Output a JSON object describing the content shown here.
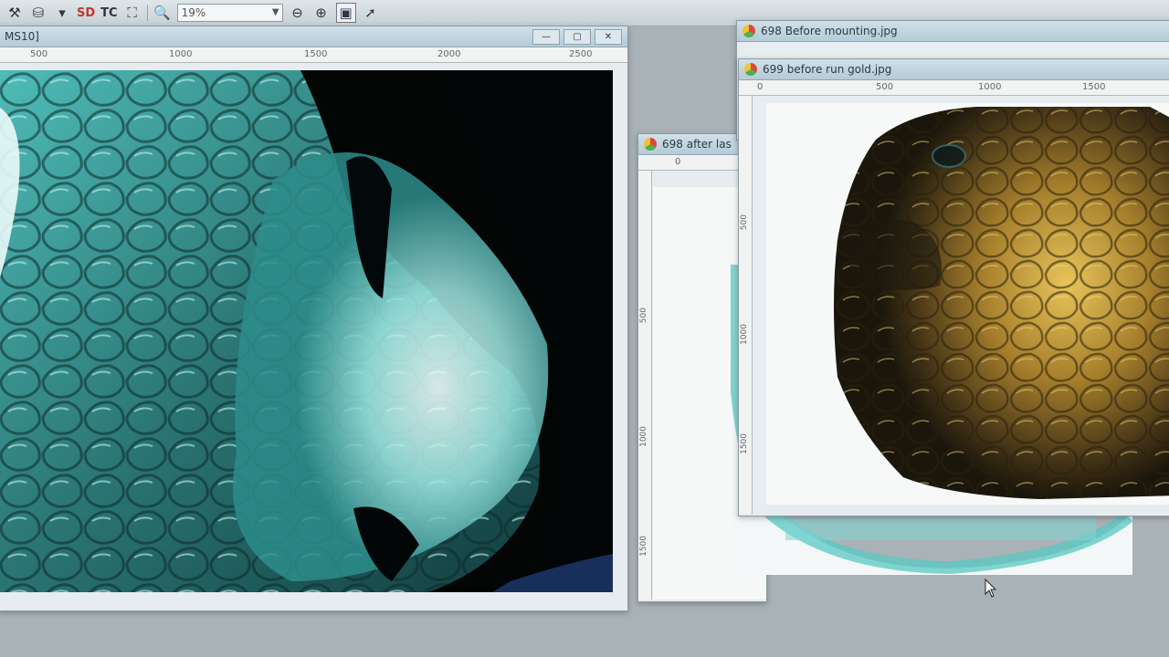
{
  "toolbar": {
    "zoom_value": "19%",
    "label_sd": "SD",
    "label_tc": "TC"
  },
  "windows": {
    "main": {
      "title": "MS10]",
      "ruler_ticks": [
        "500",
        "1000",
        "1500",
        "2000",
        "2500"
      ]
    },
    "w698_before": {
      "title": "698 Before mounting.jpg"
    },
    "w699": {
      "title": "699 before run gold.jpg",
      "ruler_ticks": [
        "0",
        "500",
        "1000",
        "1500"
      ],
      "vruler_ticks": [
        "500",
        "1000",
        "1500"
      ]
    },
    "w698_after": {
      "title": "698 after las",
      "ruler_ticks": [
        "0"
      ],
      "vruler_ticks": [
        "500",
        "1000",
        "1500"
      ]
    }
  },
  "colors": {
    "cyan_image": "#3fc6c2",
    "gold_image": "#c9a23c",
    "titlebar": "#c4d8e2"
  }
}
